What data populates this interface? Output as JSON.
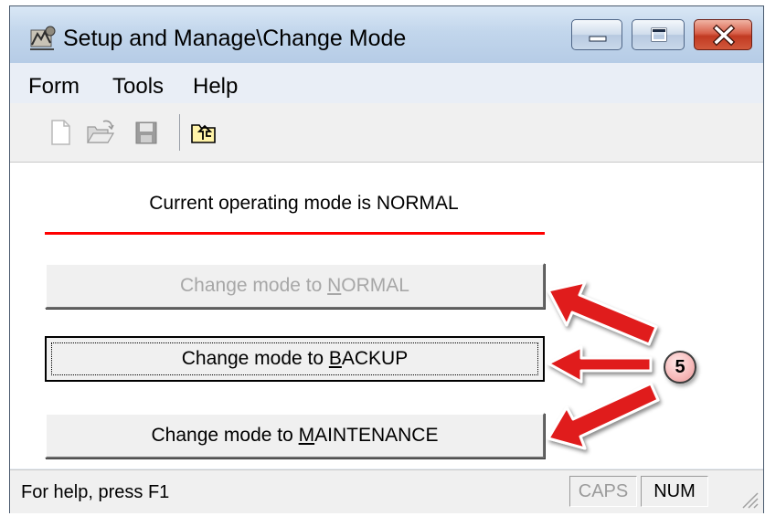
{
  "window": {
    "title": "Setup and Manage\\Change Mode"
  },
  "menubar": {
    "items": [
      "Form",
      "Tools",
      "Help"
    ]
  },
  "toolbar": {
    "icons": [
      "new-document-icon",
      "open-folder-icon",
      "save-icon",
      "folder-up-icon"
    ]
  },
  "main": {
    "mode_label": "Current operating mode is NORMAL",
    "buttons": [
      {
        "prefix": "Change mode to ",
        "mnemonic": "N",
        "rest": "ORMAL",
        "state": "disabled"
      },
      {
        "prefix": "Change mode to ",
        "mnemonic": "B",
        "rest": "ACKUP",
        "state": "focused"
      },
      {
        "prefix": "Change mode to ",
        "mnemonic": "M",
        "rest": "AINTENANCE",
        "state": "enabled"
      }
    ],
    "separator_color": "#ff0000"
  },
  "statusbar": {
    "help_text": "For help, press F1",
    "caps": "CAPS",
    "num": "NUM"
  },
  "annotation": {
    "badge": "5",
    "arrow_color": "#e01a1a"
  }
}
